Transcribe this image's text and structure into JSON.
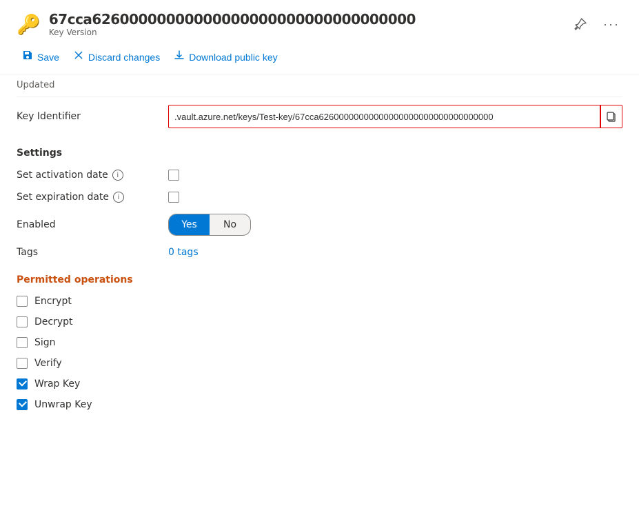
{
  "header": {
    "key_id": "67cca62600000000000000000000000000000000",
    "subtitle": "Key Version",
    "pin_icon": "📌",
    "more_icon": "···"
  },
  "toolbar": {
    "save_label": "Save",
    "discard_label": "Discard changes",
    "download_label": "Download public key"
  },
  "updated_label": "Updated",
  "key_identifier": {
    "label": "Key Identifier",
    "value": ".vault.azure.net/keys/Test-key/67cca62600000000000000000000000000000000"
  },
  "settings": {
    "header": "Settings",
    "activation_date": {
      "label": "Set activation date",
      "checked": false
    },
    "expiration_date": {
      "label": "Set expiration date",
      "checked": false
    },
    "enabled": {
      "label": "Enabled",
      "yes_label": "Yes",
      "no_label": "No",
      "value": "yes"
    },
    "tags": {
      "label": "Tags",
      "value": "0 tags"
    }
  },
  "permitted_operations": {
    "header": "Permitted operations",
    "operations": [
      {
        "id": "encrypt",
        "label": "Encrypt",
        "checked": false
      },
      {
        "id": "decrypt",
        "label": "Decrypt",
        "checked": false
      },
      {
        "id": "sign",
        "label": "Sign",
        "checked": false
      },
      {
        "id": "verify",
        "label": "Verify",
        "checked": false
      },
      {
        "id": "wrap_key",
        "label": "Wrap Key",
        "checked": true
      },
      {
        "id": "unwrap_key",
        "label": "Unwrap Key",
        "checked": true
      }
    ]
  }
}
